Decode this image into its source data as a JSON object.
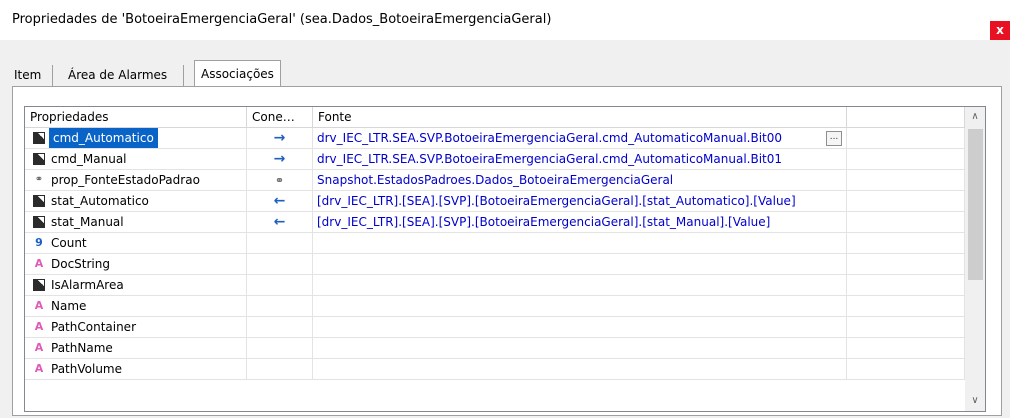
{
  "window": {
    "title": "Propriedades de 'BotoeiraEmergenciaGeral' (sea.Dados_BotoeiraEmergenciaGeral)",
    "close_label": "x"
  },
  "tabs": [
    "Item",
    "Área de Alarmes",
    "Associações"
  ],
  "grid": {
    "headers": [
      "Propriedades",
      "Cone…",
      "Fonte"
    ],
    "rows": [
      {
        "icon": "edit-square-icon",
        "name": "cmd_Automatico",
        "connection": "→",
        "source": "drv_IEC_LTR.SEA.SVP.BotoeiraEmergenciaGeral.cmd_AutomaticoManual.Bit00",
        "ellipsis": "..."
      },
      {
        "icon": "square-icon",
        "name": "cmd_Manual",
        "connection": "→",
        "source": "drv_IEC_LTR.SEA.SVP.BotoeiraEmergenciaGeral.cmd_AutomaticoManual.Bit01"
      },
      {
        "icon": "link-icon",
        "name": "prop_FonteEstadoPadrao",
        "connection": "⚭",
        "source": "Snapshot.EstadosPadroes.Dados_BotoeiraEmergenciaGeral"
      },
      {
        "icon": "square-icon",
        "name": "stat_Automatico",
        "connection": "←",
        "source": "[drv_IEC_LTR].[SEA].[SVP].[BotoeiraEmergenciaGeral].[stat_Automatico].[Value]"
      },
      {
        "icon": "square-icon",
        "name": "stat_Manual",
        "connection": "←",
        "source": "[drv_IEC_LTR].[SEA].[SVP].[BotoeiraEmergenciaGeral].[stat_Manual].[Value]"
      },
      {
        "icon": "numeric-9-icon",
        "icon_text": "9",
        "name": "Count",
        "connection": "",
        "source": ""
      },
      {
        "icon": "text-A-icon",
        "icon_text": "A",
        "name": "DocString",
        "connection": "",
        "source": ""
      },
      {
        "icon": "square-icon",
        "name": "IsAlarmArea",
        "connection": "",
        "source": ""
      },
      {
        "icon": "text-A-icon",
        "icon_text": "A",
        "name": "Name",
        "connection": "",
        "source": ""
      },
      {
        "icon": "text-A-icon",
        "icon_text": "A",
        "name": "PathContainer",
        "connection": "",
        "source": ""
      },
      {
        "icon": "text-A-icon",
        "icon_text": "A",
        "name": "PathName",
        "connection": "",
        "source": ""
      },
      {
        "icon": "text-A-icon",
        "icon_text": "A",
        "name": "PathVolume",
        "connection": "",
        "source": ""
      }
    ]
  },
  "scrollbar": {
    "up": "∧",
    "down": "∨"
  }
}
